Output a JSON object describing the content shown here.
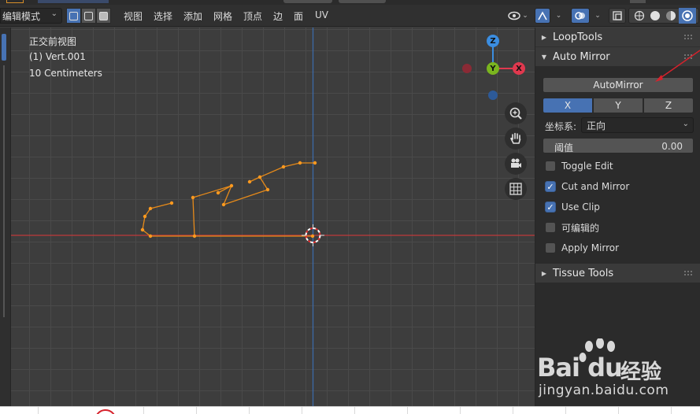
{
  "header": {
    "mode": "编辑模式",
    "menu": [
      "视图",
      "选择",
      "添加",
      "网格",
      "顶点",
      "边",
      "面",
      "UV"
    ]
  },
  "viewport": {
    "view_name": "正交前视图",
    "object": "(1) Vert.001",
    "scale": "10 Centimeters",
    "gizmo": {
      "z": "Z",
      "y": "Y",
      "x": "X"
    }
  },
  "panel": {
    "loop_tools": "LoopTools",
    "auto_mirror": "Auto Mirror",
    "auto_mirror_button": "AutoMirror",
    "axes": [
      "X",
      "Y",
      "Z"
    ],
    "active_axis": "X",
    "coord_label": "坐标系:",
    "coord_value": "正向",
    "threshold_label": "阈值",
    "threshold_value": "0.00",
    "options": [
      {
        "label": "Toggle Edit",
        "checked": false
      },
      {
        "label": "Cut and Mirror",
        "checked": true
      },
      {
        "label": "Use Clip",
        "checked": true
      },
      {
        "label": "可编辑的",
        "checked": false
      },
      {
        "label": "Apply Mirror",
        "checked": false
      }
    ],
    "tissue_tools": "Tissue Tools"
  },
  "watermark": {
    "brand": "Bai du",
    "cn": "经验",
    "url": "jingyan.baidu.com"
  },
  "colors": {
    "accent": "#4772b3",
    "edge": "#e68a1a",
    "x_axis": "#c0393b",
    "z_axis": "#3d6aa8",
    "annotation": "#d6222c"
  }
}
